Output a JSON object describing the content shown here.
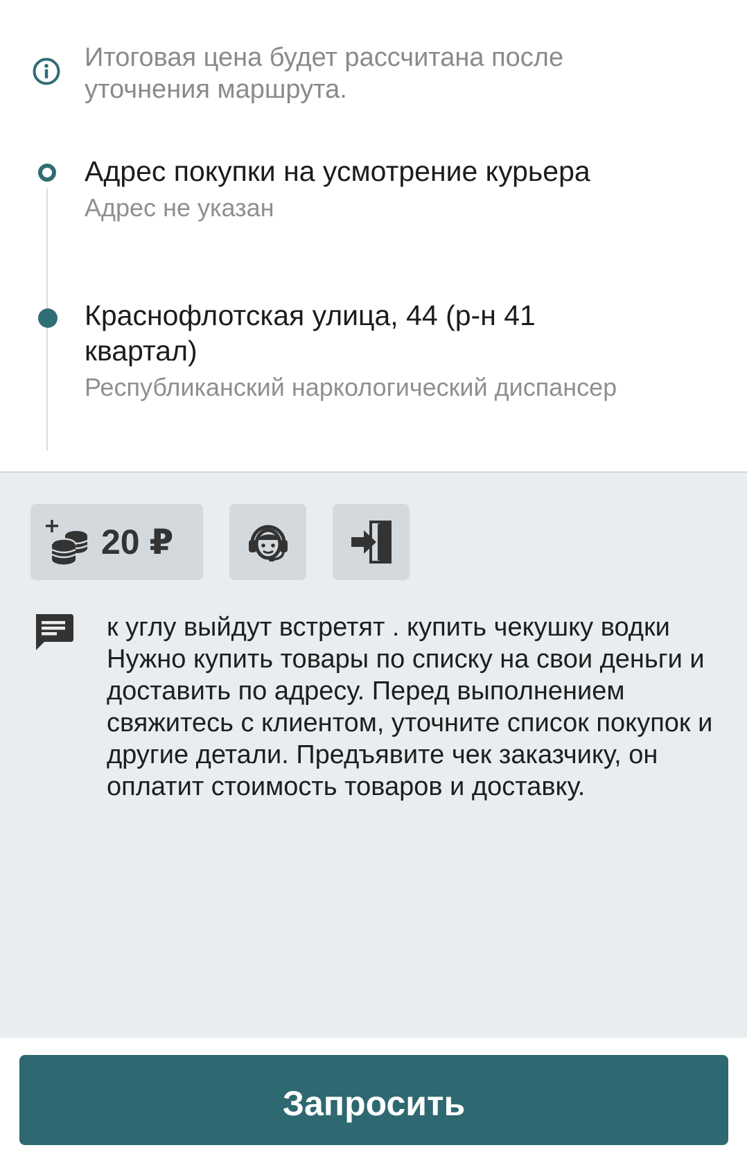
{
  "info": {
    "text": "Итоговая цена будет рассчитана после уточнения маршрута.",
    "icon": "info-icon"
  },
  "route": {
    "stops": [
      {
        "title": "Адрес покупки на усмотрение курьера",
        "subtitle": "Адрес не указан",
        "marker": "hollow-dot"
      },
      {
        "title": "Краснофлотская улица, 44 (р-н 41 квартал)",
        "subtitle": "Республиканский наркологический диспансер",
        "marker": "filled-dot"
      }
    ]
  },
  "actions": {
    "tip_amount": "20 ₽",
    "tip_icon": "add-coins-icon",
    "support_icon": "support-operator-icon",
    "exit_icon": "door-enter-icon"
  },
  "comment": {
    "icon": "comment-icon",
    "text": "к углу выйдут встретят . купить чекушку водки Нужно купить товары по списку на свои деньги и доставить по адресу. Перед выполнением свяжитесь с клиентом, уточните список покупок и другие детали. Предъявите чек заказчику, он оплатит стоимость товаров и доставку."
  },
  "submit": {
    "label": "Запросить"
  },
  "colors": {
    "accent": "#2e6e74",
    "button": "#2e6870",
    "panel_bg": "#e9edf0",
    "chip_bg": "#d4d9dd",
    "muted_text": "#8a8a8a"
  }
}
